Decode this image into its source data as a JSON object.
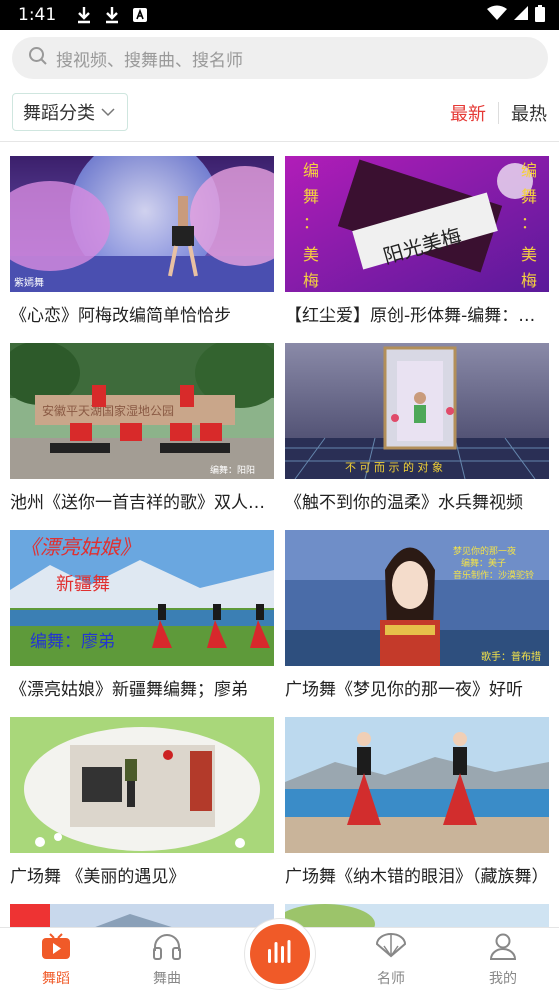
{
  "status": {
    "time": "1:41",
    "icons": [
      "download-icon",
      "download-icon",
      "app-notification-icon",
      "wifi-icon",
      "signal-icon",
      "battery-icon"
    ]
  },
  "search": {
    "placeholder": "搜视频、搜舞曲、搜名师"
  },
  "filter": {
    "category_label": "舞蹈分类",
    "sort_new": "最新",
    "sort_hot": "最热"
  },
  "colors": {
    "accent": "#f05a28",
    "active_sort": "#e53935"
  },
  "videos": [
    {
      "title": "《心恋》阿梅改编简单恰恰步"
    },
    {
      "title": "【红尘爱】原创-形体舞-编舞：美梅"
    },
    {
      "title": "池州《送你一首吉祥的歌》双人对跳"
    },
    {
      "title": "《触不到你的温柔》水兵舞视频"
    },
    {
      "title": "《漂亮姑娘》新疆舞编舞；廖弟"
    },
    {
      "title": "广场舞《梦见你的那一夜》好听"
    },
    {
      "title": "广场舞 《美丽的遇见》"
    },
    {
      "title": "广场舞《纳木错的眼泪》（藏族舞）"
    }
  ],
  "thumb_text": {
    "v1_corner": "紫嫣舞",
    "v2_left": [
      "编",
      "舞",
      "：",
      "美",
      "梅"
    ],
    "v2_right": [
      "编",
      "舞",
      "：",
      "美",
      "梅"
    ],
    "v2_banner": "阳光美梅",
    "v3_sign": "安徽平天湖国家湿地公园",
    "v3_credit": "编舞：阳阳",
    "v4_caption": "不 可 而 示 的 对 象",
    "v5_title": "《漂亮姑娘》",
    "v5_sub": "新疆舞",
    "v5_credit": "编舞：廖弟",
    "v6_lines": [
      "梦见你的那一夜",
      "编舞：美子",
      "音乐制作：沙漠驼铃"
    ],
    "v6_singer": "歌手：普布措"
  },
  "tabs": [
    {
      "label": "舞蹈",
      "icon": "play-tv-icon",
      "active": true
    },
    {
      "label": "舞曲",
      "icon": "headphones-icon",
      "active": false
    },
    {
      "label": "",
      "icon": "audio-bars-icon",
      "active": false
    },
    {
      "label": "名师",
      "icon": "fan-icon",
      "active": false
    },
    {
      "label": "我的",
      "icon": "person-icon",
      "active": false
    }
  ]
}
